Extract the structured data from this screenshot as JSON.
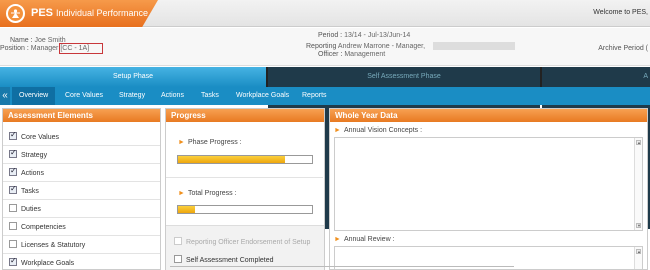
{
  "header": {
    "brand": "PES",
    "brand_sub": "Individual Performance",
    "welcome": "Welcome to PES,"
  },
  "info": {
    "name_label": "Name",
    "name_value": "Joe Smith",
    "position_label": "Position",
    "position_value": "Manager [CC - 1A]",
    "period_label": "Period",
    "period_value": "13/14 - Jul-13/Jun-14",
    "reporting_label": "Reporting",
    "reporting_value": "Andrew Marrone - Manager,",
    "officer_label": "Officer",
    "officer_value": "Management",
    "archive": "Archive Period ("
  },
  "phases": {
    "setup": "Setup Phase",
    "self_assessment": "Self Assessment Phase",
    "third_mark": "A"
  },
  "nav": {
    "back_glyph": "«",
    "tabs": [
      "Overview",
      "Core Values",
      "Strategy",
      "Actions",
      "Tasks",
      "Workplace Goals",
      "Reports"
    ],
    "active": "Overview"
  },
  "assessment": {
    "title": "Assessment Elements",
    "items": [
      {
        "label": "Core Values",
        "checked": true
      },
      {
        "label": "Strategy",
        "checked": true
      },
      {
        "label": "Actions",
        "checked": true
      },
      {
        "label": "Tasks",
        "checked": true
      },
      {
        "label": "Duties",
        "checked": false
      },
      {
        "label": "Competencies",
        "checked": false
      },
      {
        "label": "Licenses & Statutory",
        "checked": false
      },
      {
        "label": "Workplace Goals",
        "checked": true
      }
    ]
  },
  "progress": {
    "title": "Progress",
    "phase_label": "Phase Progress :",
    "phase_value": 0.8,
    "total_label": "Total Progress :",
    "total_value": 0.13,
    "endorsement_label": "Reporting Officer Endorsement of Setup",
    "self_assessment_label": "Self Assessment Completed"
  },
  "whole_year": {
    "title": "Whole Year Data",
    "vision_label": "Annual Vision Concepts :",
    "review_label": "Annual Review :"
  },
  "colors": {
    "accent_orange": "#e87a22",
    "nav_blue": "#1a8dc4",
    "progress_yellow": "#eea60e"
  }
}
